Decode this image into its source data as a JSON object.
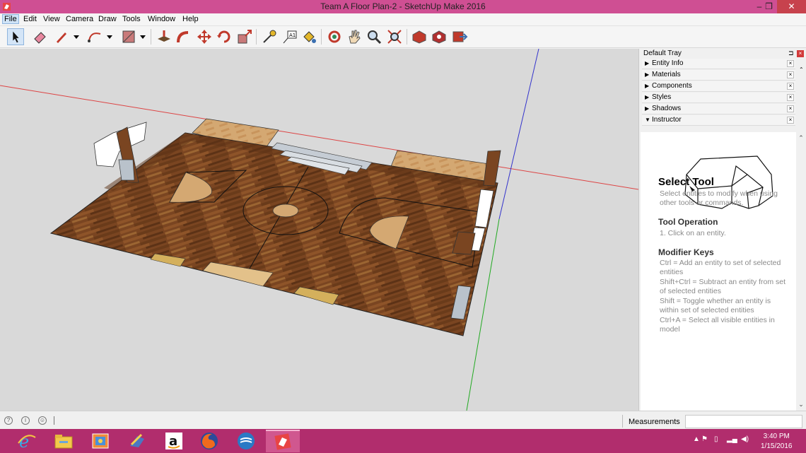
{
  "window": {
    "title": "Team A Floor Plan-2 - SketchUp Make 2016",
    "minimize": "–",
    "restore": "❐",
    "close": "✕"
  },
  "menu": [
    "File",
    "Edit",
    "View",
    "Camera",
    "Draw",
    "Tools",
    "Window",
    "Help"
  ],
  "toolbar": [
    "select",
    "eraser",
    "pencil",
    "arc",
    "shape",
    "push-pull",
    "follow-me",
    "move",
    "rotate",
    "scale",
    "tape-measure",
    "text",
    "paint-bucket",
    "orbit",
    "pan",
    "zoom",
    "zoom-extents",
    "3d-warehouse",
    "extension-warehouse",
    "share-model"
  ],
  "tray": {
    "title": "Default Tray",
    "pin": "⊐",
    "close": "×",
    "panels": [
      {
        "label": "Entity Info",
        "arrow": "▶"
      },
      {
        "label": "Materials",
        "arrow": "▶"
      },
      {
        "label": "Components",
        "arrow": "▶"
      },
      {
        "label": "Styles",
        "arrow": "▶"
      },
      {
        "label": "Shadows",
        "arrow": "▶"
      },
      {
        "label": "Instructor",
        "arrow": "▼"
      }
    ],
    "panel_close": "×"
  },
  "instructor": {
    "title": "Select Tool",
    "desc": "Select entities to modify when using other tools or commands.",
    "op_heading": "Tool Operation",
    "op_1": "1.  Click on an entity.",
    "mod_heading": "Modifier Keys",
    "mod_1": "Ctrl = Add an entity to set of selected entities",
    "mod_2": "Shift+Ctrl = Subtract an entity from set of selected entities",
    "mod_3": "Shift = Toggle whether an entity is within set of selected entities",
    "mod_4": "Ctrl+A = Select all visible entities in model"
  },
  "scroll": {
    "up": "⌃",
    "down": "⌄"
  },
  "status": {
    "measurements_label": "Measurements",
    "measurements_value": ""
  },
  "taskbar": {
    "apps": [
      "internet-explorer",
      "file-explorer",
      "photos",
      "paint",
      "amazon",
      "firefox",
      "word-like",
      "sketchup"
    ],
    "time": "3:40 PM",
    "date": "1/15/2016"
  },
  "colors": {
    "title_bar": "#cf4f93",
    "taskbar": "#b12d6d",
    "floor": "#7a4521",
    "viewport": "#d9d9d9"
  }
}
